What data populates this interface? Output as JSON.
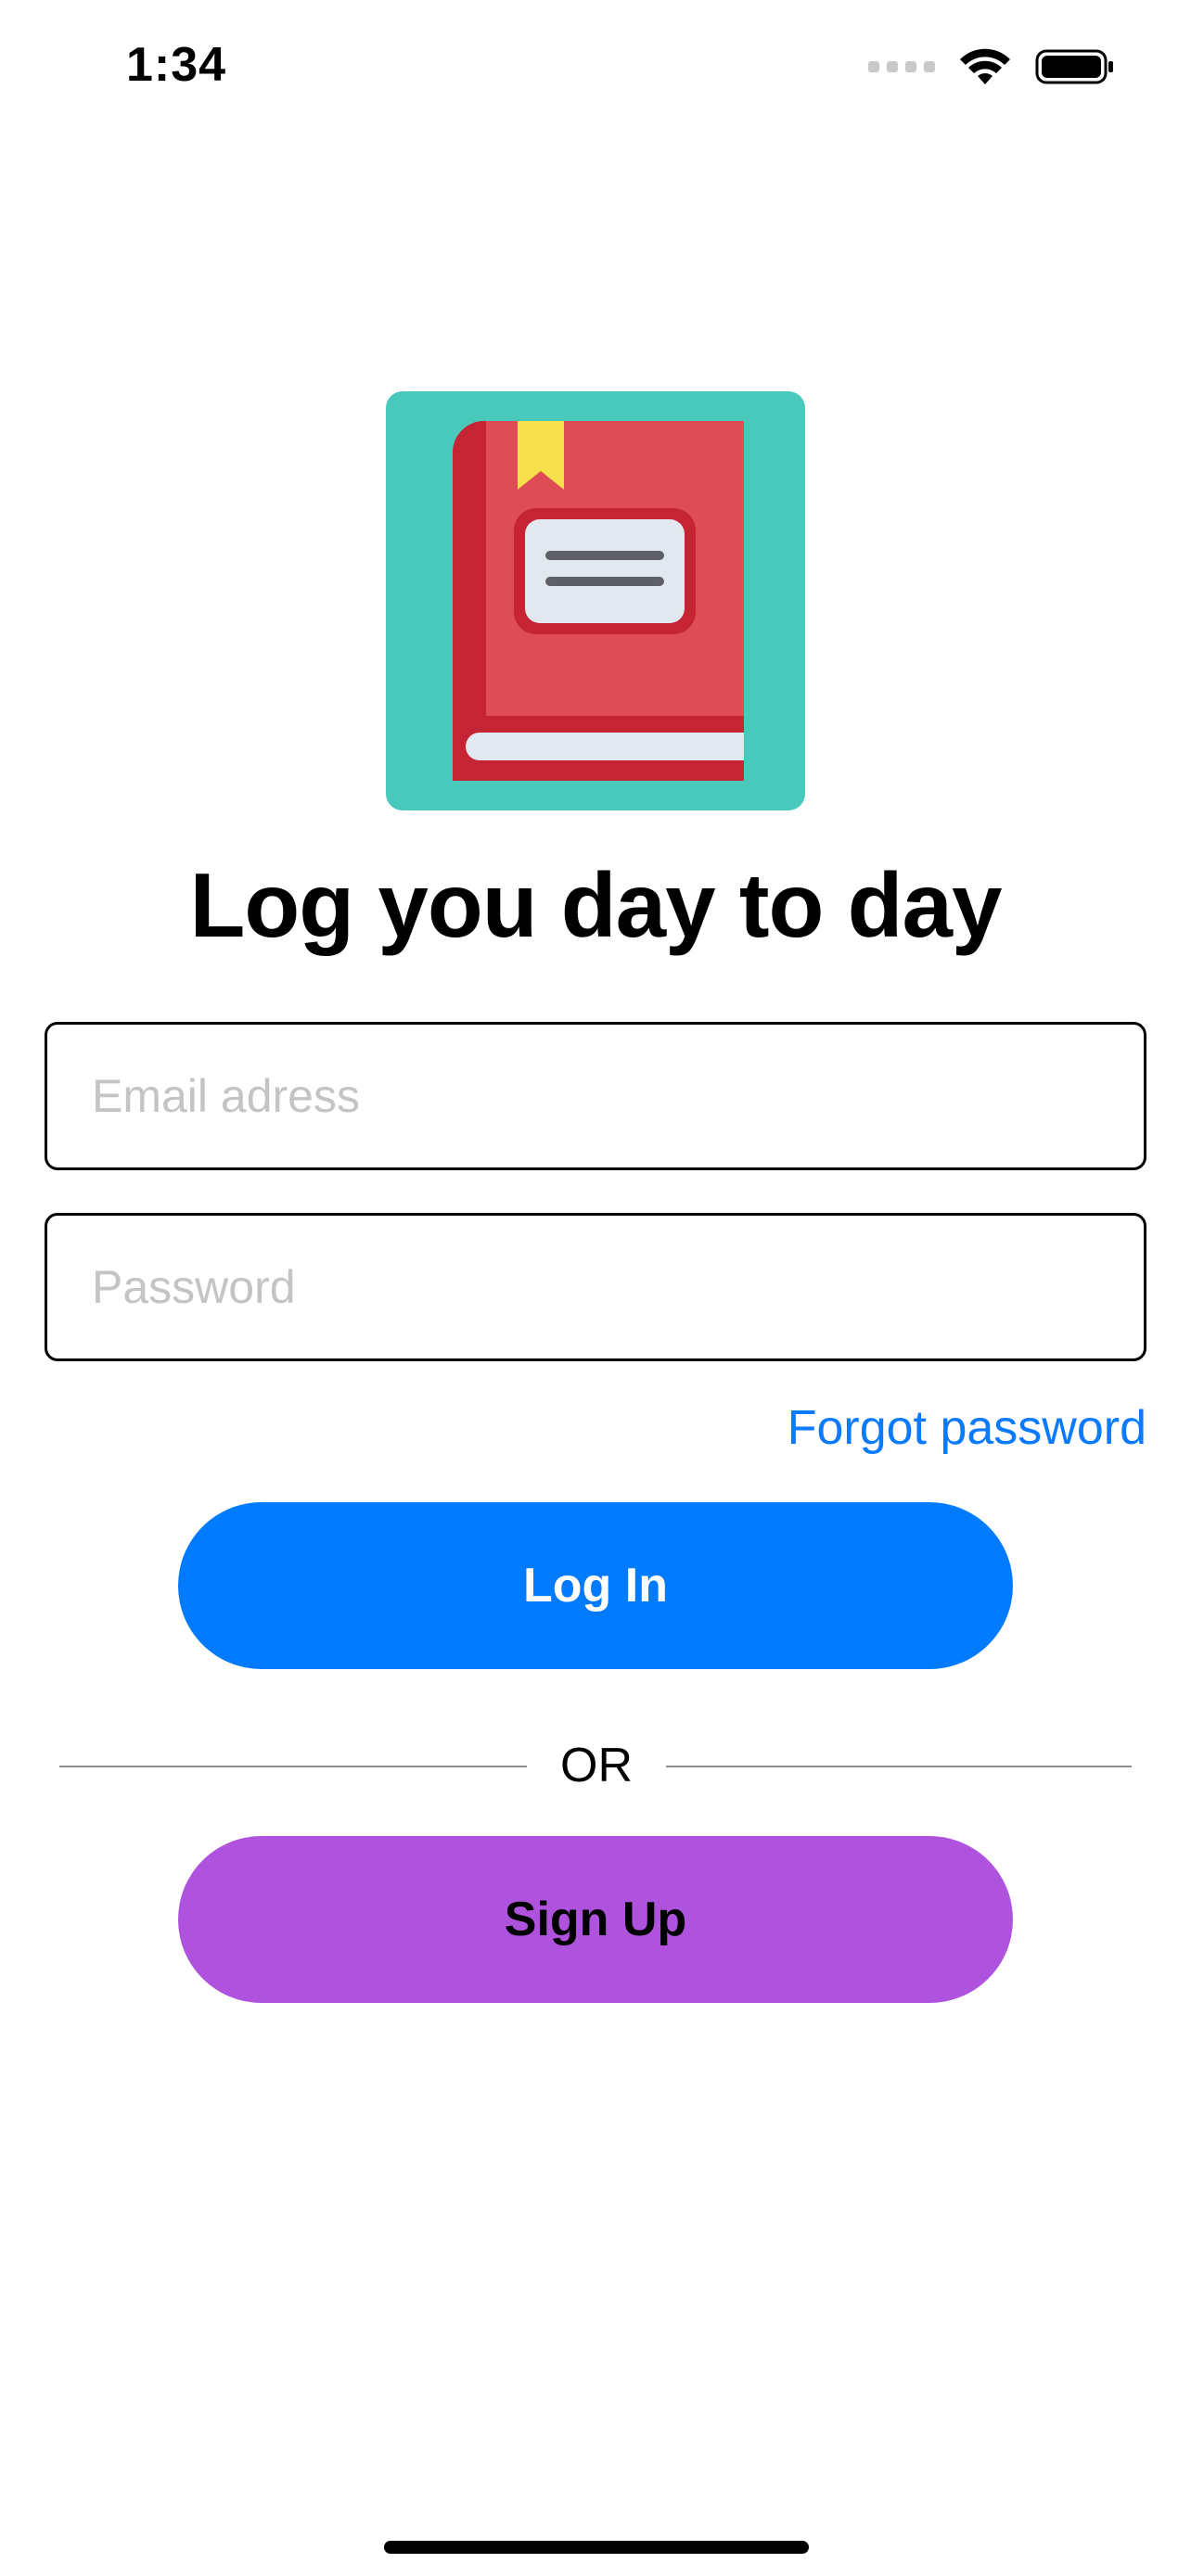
{
  "status_bar": {
    "time": "1:34"
  },
  "app": {
    "icon": "book-icon",
    "headline": "Log you day to day"
  },
  "form": {
    "email": {
      "placeholder": "Email adress",
      "value": ""
    },
    "password": {
      "placeholder": "Password",
      "value": ""
    },
    "forgot_label": "Forgot password"
  },
  "actions": {
    "login_label": "Log In",
    "divider_label": "OR",
    "signup_label": "Sign Up"
  },
  "colors": {
    "accent_blue": "#007aff",
    "link_blue": "#0a7aff",
    "signup_purple": "#af52de",
    "icon_teal": "#48c9bb",
    "book_red": "#de4d56"
  }
}
